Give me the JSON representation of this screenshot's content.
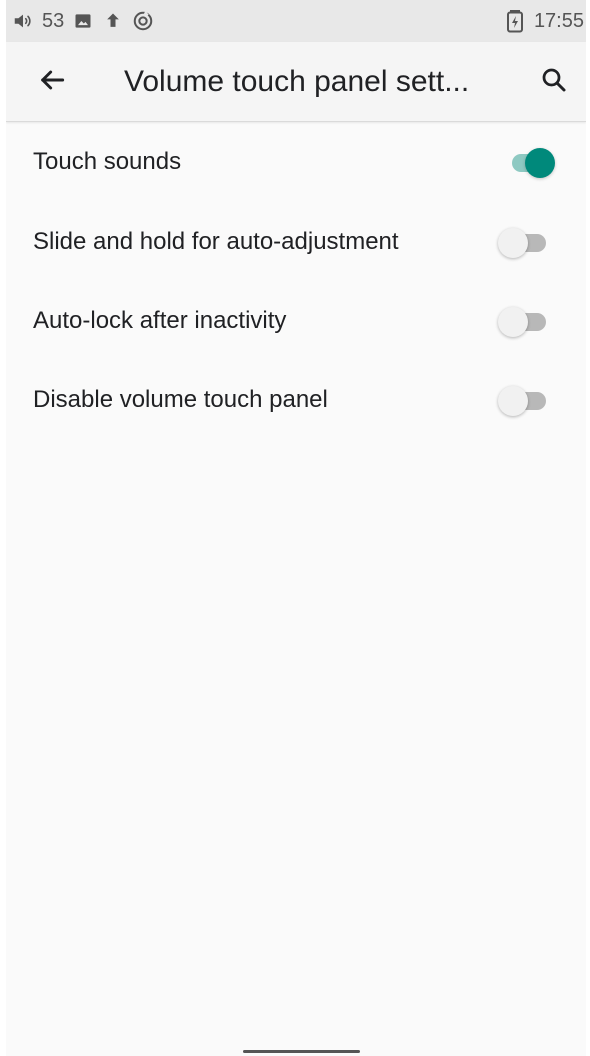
{
  "status_bar": {
    "left_icons": [
      "volume-icon",
      "image-icon",
      "upload-icon",
      "data-saver-icon"
    ],
    "volume_level": "53",
    "battery_icon": "battery-charging-icon",
    "time": "17:55"
  },
  "app_bar": {
    "title": "Volume touch panel sett...",
    "back_icon": "arrow-left-icon",
    "search_icon": "search-icon"
  },
  "settings": [
    {
      "label": "Touch sounds",
      "enabled": true
    },
    {
      "label": "Slide and hold for auto-adjustment",
      "enabled": false
    },
    {
      "label": "Auto-lock after inactivity",
      "enabled": false
    },
    {
      "label": "Disable volume touch panel",
      "enabled": false
    }
  ],
  "colors": {
    "accent": "#00897b",
    "accent_track": "#8ec9c2",
    "switch_off_thumb": "#f1f1f1",
    "switch_off_track": "#b8b8b8",
    "background": "#fafafa",
    "status_bar": "#e8e8e8"
  }
}
